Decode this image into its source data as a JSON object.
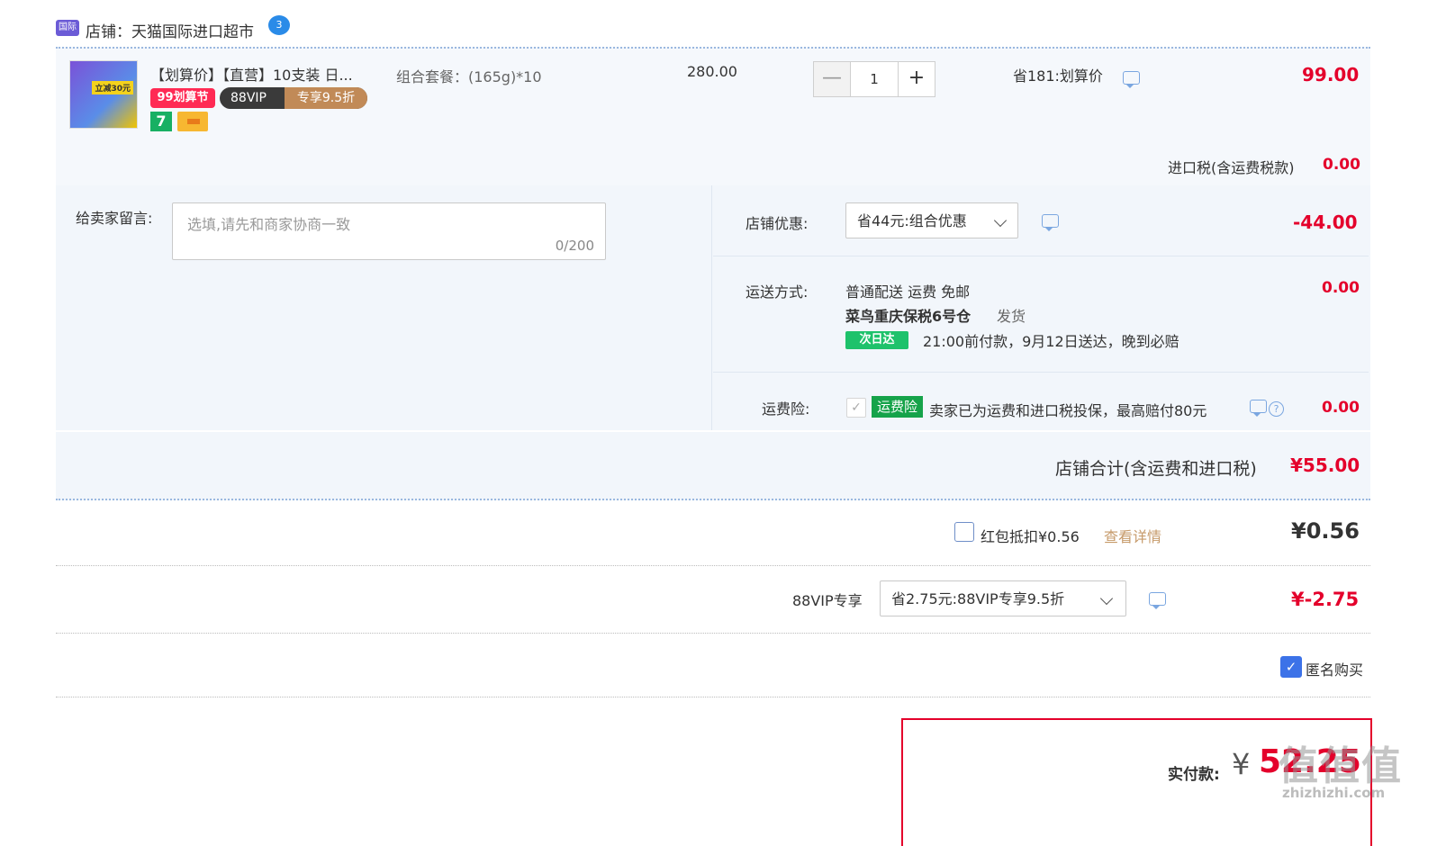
{
  "store": {
    "badge": "国际",
    "label": "店铺：天猫国际进口超市"
  },
  "item": {
    "title": "【划算价】【直营】10支装 日...",
    "spec": "组合套餐：(165g)*10",
    "unit_price": "280.00",
    "quantity": "1",
    "stepper_minus": "—",
    "stepper_plus": "+",
    "promo": "省181:划算价",
    "final_price": "99.00",
    "badges": {
      "sale": "99划算节",
      "vip_left": "88VIP",
      "vip_right": "专享9.5折",
      "seven": "7"
    },
    "thumb_tag": "立减30元"
  },
  "import_tax": {
    "label": "进口税(含运费税款)",
    "value": "0.00"
  },
  "message": {
    "label": "给卖家留言:",
    "placeholder": "选填,请先和商家协商一致",
    "counter": "0/200"
  },
  "store_discount": {
    "label": "店铺优惠:",
    "selected": "省44元:组合优惠",
    "value": "-44.00"
  },
  "shipping": {
    "label": "运送方式:",
    "method": "普通配送 运费 免邮",
    "warehouse": "菜鸟重庆保税6号仓",
    "ship_text": "发货",
    "badge": "次日达",
    "eta": "21:00前付款，9月12日送达，晚到必赔",
    "value": "0.00"
  },
  "insurance": {
    "label": "运费险:",
    "check_mark": "✓",
    "tag": "运费险",
    "desc": "卖家已为运费和进口税投保，最高赔付80元",
    "help": "?",
    "value": "0.00"
  },
  "store_total": {
    "label": "店铺合计(含运费和进口税)",
    "value": "¥55.00"
  },
  "red_packet": {
    "label": "红包抵扣¥0.56",
    "link": "查看详情",
    "value": "¥0.56"
  },
  "vip": {
    "label": "88VIP专享",
    "selected": "省2.75元:88VIP专享9.5折",
    "value": "¥-2.75"
  },
  "anonymous": {
    "check_mark": "✓",
    "label": "匿名购买"
  },
  "payment": {
    "label": "实付款:",
    "currency": "¥",
    "amount": "52.25"
  },
  "watermark": {
    "text": "值值值",
    "sub": "zhizhizhi.com"
  },
  "colors": {
    "accent_red": "#e4002b",
    "panel_bg": "#f2f6fb",
    "link_orange": "#c69a6a",
    "checkbox_blue": "#3c72e8"
  }
}
